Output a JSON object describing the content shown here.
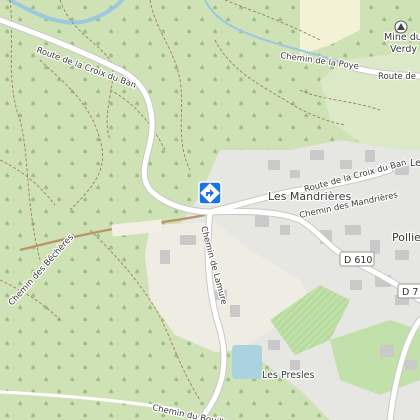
{
  "map": {
    "place_labels": {
      "mine_line1": "Mine du",
      "mine_line2": "Verdy",
      "mandrieres": "Les Mandrières",
      "presles": "Les Presles",
      "pollie": "Pollie",
      "le": "Le"
    },
    "road_labels": {
      "croix_du_ban_west": "Route de la Croix du Ban",
      "chemin_poye": "Chemin de la Poye",
      "route_de_east": "Route de",
      "croix_du_ban_east": "Route de la Croix du Ban",
      "chemin_mandrieres": "Chemin des Mandrières",
      "chemin_lamure": "Chemin de Lamure",
      "chemin_bechers": "Chemin des Bêchères",
      "chemin_bouillon": "Chemin du Bouillon"
    },
    "shields": {
      "d610": "D 610",
      "d7": "D 7"
    },
    "marker_icon": "directions-diamond-icon",
    "mine_icon": "mine-icon",
    "colors": {
      "forest": "#cfe2b6",
      "forest_dark": "#bcd7a0",
      "clearing": "#eef0e4",
      "urban": "#e3e3e3",
      "building": "#c9c9c9",
      "water": "#aad3df",
      "river": "#9cc8e0",
      "road": "#ffffff",
      "road_casing": "#c8c8c8",
      "track": "#a08a5c",
      "marker": "#1a73e8"
    }
  }
}
